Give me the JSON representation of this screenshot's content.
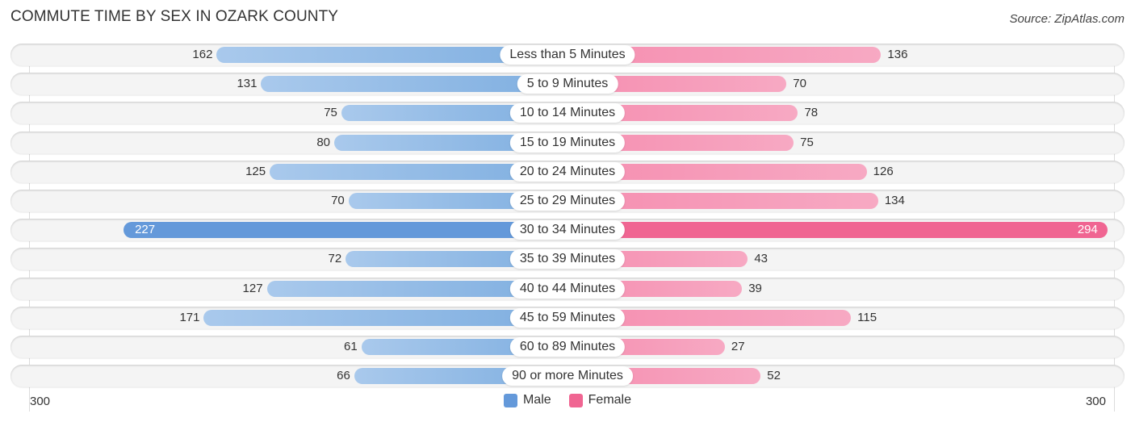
{
  "header": {
    "title": "COMMUTE TIME BY SEX IN OZARK COUNTY",
    "source": "Source: ZipAtlas.com"
  },
  "colors": {
    "male": "#6499da",
    "female": "#f06592"
  },
  "chart_data": {
    "type": "bar",
    "orientation": "horizontal-diverging",
    "title": "COMMUTE TIME BY SEX IN OZARK COUNTY",
    "xlabel": "",
    "ylabel": "",
    "xlim": [
      -300,
      300
    ],
    "tick_labels": {
      "left": "300",
      "right": "300"
    },
    "legend_position": "bottom-center",
    "categories": [
      "Less than 5 Minutes",
      "5 to 9 Minutes",
      "10 to 14 Minutes",
      "15 to 19 Minutes",
      "20 to 24 Minutes",
      "25 to 29 Minutes",
      "30 to 34 Minutes",
      "35 to 39 Minutes",
      "40 to 44 Minutes",
      "45 to 59 Minutes",
      "60 to 89 Minutes",
      "90 or more Minutes"
    ],
    "series": [
      {
        "name": "Male",
        "side": "left",
        "values": [
          162,
          131,
          75,
          80,
          125,
          70,
          227,
          72,
          127,
          171,
          61,
          66
        ]
      },
      {
        "name": "Female",
        "side": "right",
        "values": [
          136,
          70,
          78,
          75,
          126,
          134,
          294,
          43,
          39,
          115,
          27,
          52
        ]
      }
    ]
  },
  "legend": [
    {
      "label": "Male"
    },
    {
      "label": "Female"
    }
  ]
}
